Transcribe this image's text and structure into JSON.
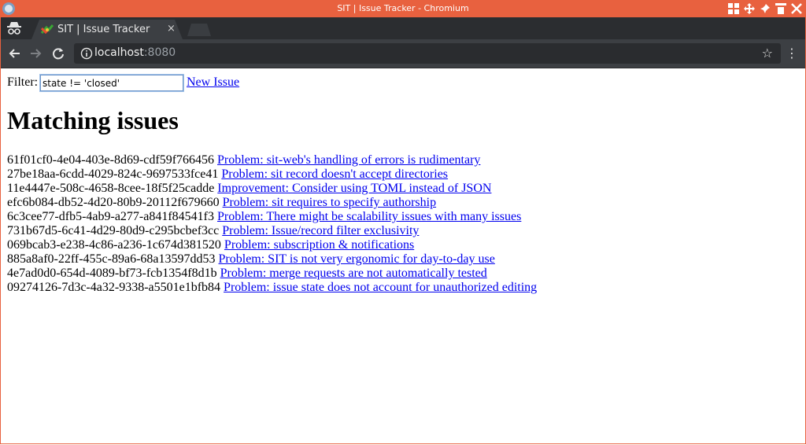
{
  "window": {
    "title": "SIT | Issue Tracker - Chromium"
  },
  "tab": {
    "title": "SIT | Issue Tracker",
    "close": "×"
  },
  "omnibox": {
    "host": "localhost",
    "port": ":8080"
  },
  "page": {
    "filter_label": "Filter:",
    "filter_value": "state != 'closed'",
    "new_issue": "New Issue",
    "heading": "Matching issues",
    "issues": [
      {
        "id": "61f01cf0-4e04-403e-8d69-cdf59f766456",
        "title": "Problem: sit-web's handling of errors is rudimentary"
      },
      {
        "id": "27be18aa-6cdd-4029-824c-9697533fce41",
        "title": "Problem: sit record doesn't accept directories"
      },
      {
        "id": "11e4447e-508c-4658-8cee-18f5f25cadde",
        "title": "Improvement: Consider using TOML instead of JSON"
      },
      {
        "id": "efc6b084-db52-4d20-80b9-20112f679660",
        "title": "Problem: sit requires to specify authorship"
      },
      {
        "id": "6c3cee77-dfb5-4ab9-a277-a841f84541f3",
        "title": "Problem: There might be scalability issues with many issues"
      },
      {
        "id": "731b67d5-6c41-4d29-80d9-c295bcbef3cc",
        "title": "Problem: Issue/record filter exclusivity"
      },
      {
        "id": "069bcab3-e238-4c86-a236-1c674d381520",
        "title": "Problem: subscription & notifications"
      },
      {
        "id": "885a8af0-22ff-455c-89a6-68a13597dd53",
        "title": "Problem: SIT is not very ergonomic for day-to-day use"
      },
      {
        "id": "4e7ad0d0-654d-4089-bf73-fcb1354f8d1b",
        "title": "Problem: merge requests are not automatically tested"
      },
      {
        "id": "09274126-7d3c-4a32-9338-a5501e1bfb84",
        "title": "Problem: issue state does not account for unauthorized editing"
      }
    ]
  },
  "colors": {
    "titlebar": "#e8613f",
    "tabstrip": "#2b2d30",
    "toolbar": "#3c3f43",
    "link": "#0000ee"
  },
  "icons": [
    "chromium-app-icon",
    "incognito-icon",
    "sit-favicon",
    "back-arrow-icon",
    "forward-arrow-icon",
    "reload-icon",
    "info-icon",
    "bookmark-star-icon",
    "menu-dots-icon"
  ]
}
